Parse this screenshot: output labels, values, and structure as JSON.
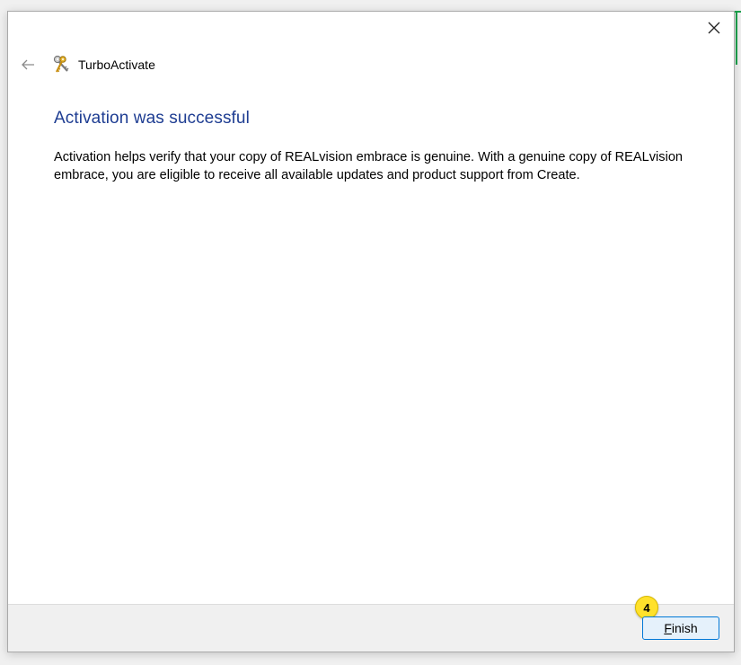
{
  "window": {
    "app_title": "TurboActivate"
  },
  "content": {
    "heading": "Activation was successful",
    "body": "Activation helps verify that your copy of REALvision embrace is genuine. With a genuine copy of REALvision embrace, you are eligible to receive all available updates and product support from Create."
  },
  "footer": {
    "finish_mnemonic": "F",
    "finish_rest": "inish",
    "step_badge": "4"
  },
  "icons": {
    "close": "close-icon",
    "back": "back-arrow-icon",
    "app": "keys-icon"
  },
  "colors": {
    "heading": "#1e3d92",
    "button_border": "#0078d7",
    "button_bg": "#e5f1fb",
    "badge": "#ffe12b"
  }
}
